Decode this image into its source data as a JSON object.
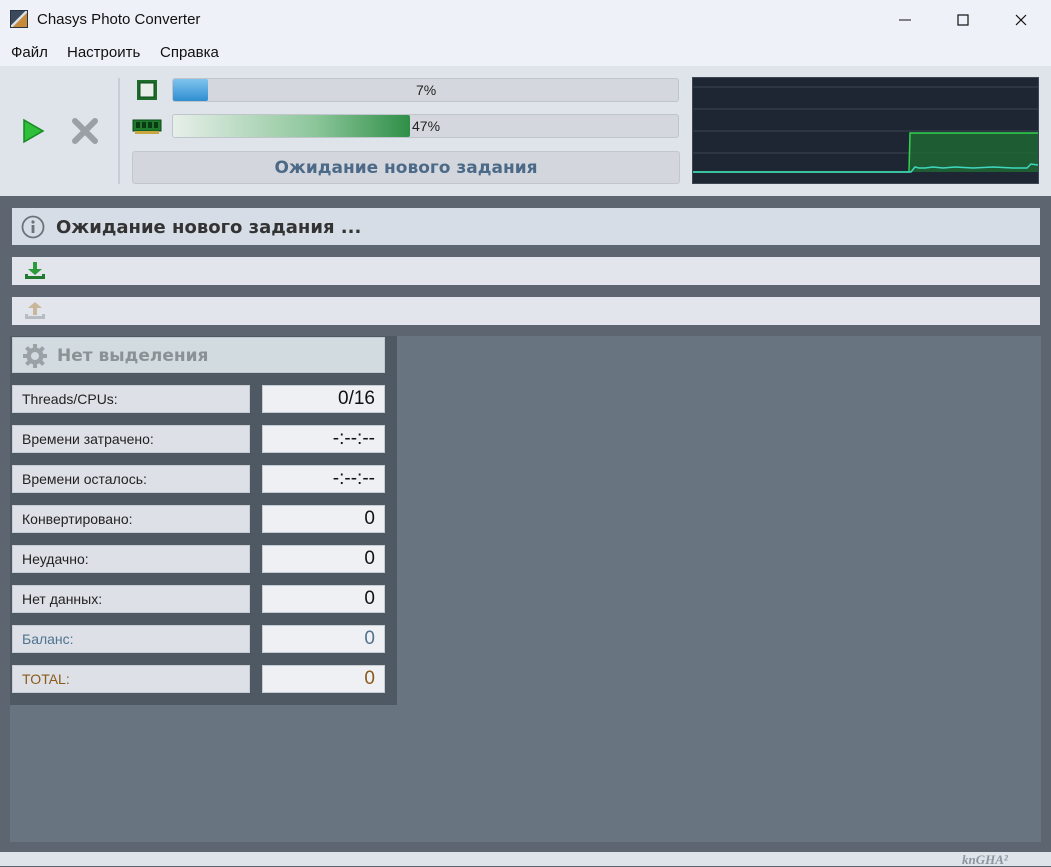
{
  "window": {
    "title": "Chasys Photo Converter"
  },
  "menu": [
    "Файл",
    "Настроить",
    "Справка"
  ],
  "toolbar": {
    "cpu_percent_label": "7%",
    "cpu_progress": 0.07,
    "ram_percent_label": "47%",
    "ram_progress": 0.47,
    "status": "Ожидание нового задания"
  },
  "info": {
    "message": "Ожидание нового задания ..."
  },
  "selection": {
    "header": "Нет выделения"
  },
  "stats": [
    {
      "label": "Threads/CPUs:",
      "value": "0/16",
      "color": "#111111"
    },
    {
      "label": "Времени затрачено:",
      "value": "-:--:--",
      "color": "#111111"
    },
    {
      "label": "Времени осталось:",
      "value": "-:--:--",
      "color": "#111111"
    },
    {
      "label": "Конвертировано:",
      "value": "0",
      "color": "#111111"
    },
    {
      "label": "Неудачно:",
      "value": "0",
      "color": "#111111"
    },
    {
      "label": "Нет данных:",
      "value": "0",
      "color": "#111111"
    },
    {
      "label": "Баланс:",
      "value": "0",
      "color": "#4f7390"
    },
    {
      "label": "TOTAL:",
      "value": "0",
      "color": "#8a5a1a"
    }
  ],
  "footer": {
    "logo": "knGHA²"
  },
  "colors": {
    "accent_blue": "#4c6a88",
    "graph_line_ram": "#33d34f",
    "graph_line_cpu": "#3fd9c0",
    "graph_bg": "#1d2632"
  }
}
